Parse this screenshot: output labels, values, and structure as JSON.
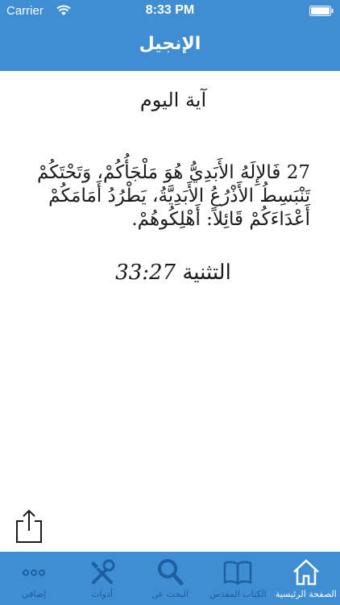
{
  "status_bar": {
    "carrier": "Carrier",
    "time": "8:33 PM"
  },
  "nav": {
    "title": "الإنجيل"
  },
  "verse": {
    "heading": "آية اليوم",
    "text": "27 فَالإِلَهُ الأَبَدِيُّ هُوَ مَلْجَأُكُمْ، وَتَحْتَكُمْ تَنْبَسِطُ الأَذْرُعُ الأَبَدِيَّةُ، يَطْرُدُ أَمَامَكُمْ أَعْدَاءَكُمْ قَائِلاً: أَهْلِكُوهُمْ.",
    "reference_book": "التثنية",
    "reference_num": "33:27"
  },
  "tabs": [
    {
      "label": "الصفحة الرئيسية",
      "icon": "home-icon",
      "active": true
    },
    {
      "label": "الكتاب المقدس",
      "icon": "book-icon",
      "active": false
    },
    {
      "label": "البحث عن",
      "icon": "search-icon",
      "active": false
    },
    {
      "label": "أدوات",
      "icon": "tools-icon",
      "active": false
    },
    {
      "label": "إضافي",
      "icon": "more-icon",
      "active": false
    }
  ],
  "colors": {
    "accent": "#3f8ed3",
    "tab_inactive": "#1d5fa0",
    "tab_active": "#ffffff"
  }
}
